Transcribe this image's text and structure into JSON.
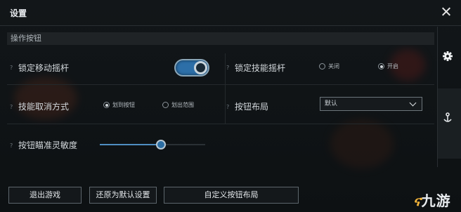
{
  "window": {
    "title": "设置"
  },
  "section": {
    "title": "操作按钮"
  },
  "settings": {
    "lock_move_stick": {
      "help": "?",
      "label": "锁定移动摇杆",
      "enabled": true
    },
    "lock_skill_stick": {
      "help": "?",
      "label": "锁定技能摇杆",
      "options": [
        "关闭",
        "开启"
      ],
      "selected": "开启"
    },
    "cancel_skill": {
      "help": "?",
      "label": "技能取消方式",
      "options": [
        "划到按钮",
        "划出范围"
      ],
      "selected": "划到按钮"
    },
    "button_layout": {
      "help": "?",
      "label": "按钮布局",
      "value": "默认"
    },
    "aim_sensitivity": {
      "help": "?",
      "label": "按钮瞄准灵敏度",
      "value": 0.58
    }
  },
  "buttons": {
    "exit": "退出游戏",
    "reset": "还原为默认设置",
    "customize": "自定义按钮布局"
  },
  "side_tabs": [
    {
      "icon": "gear-icon"
    },
    {
      "icon": "anchor-icon"
    }
  ],
  "watermark": {
    "text": "九游"
  },
  "colors": {
    "accent": "#2d6fa8",
    "panel": "#121619"
  }
}
